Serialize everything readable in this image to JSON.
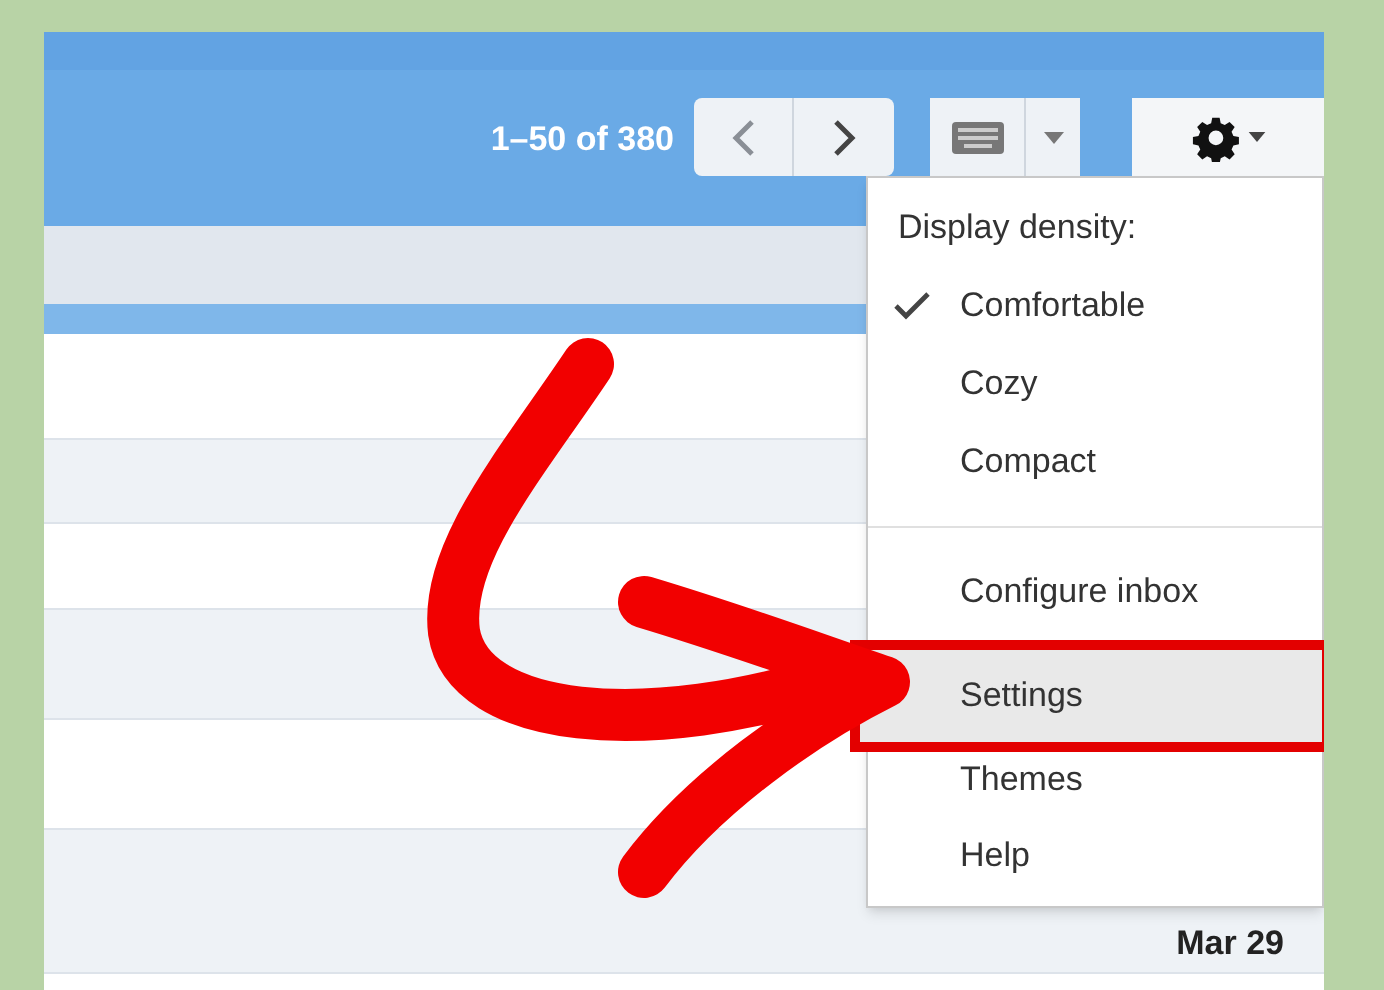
{
  "toolbar": {
    "pagination": "1–50 of 380"
  },
  "settings_menu": {
    "items": [
      {
        "kind": "heading",
        "label": "Display density:"
      },
      {
        "kind": "density",
        "label": "Comfortable",
        "checked": true
      },
      {
        "kind": "density",
        "label": "Cozy",
        "checked": false
      },
      {
        "kind": "density",
        "label": "Compact",
        "checked": false
      },
      {
        "kind": "divider"
      },
      {
        "kind": "action",
        "label": "Configure inbox",
        "selected": false
      },
      {
        "kind": "action",
        "label": "Settings",
        "selected": true
      },
      {
        "kind": "action",
        "label": "Themes",
        "selected": false
      },
      {
        "kind": "action",
        "label": "Help",
        "selected": false
      }
    ]
  },
  "email_list": {
    "rows": [
      {
        "date": ""
      },
      {
        "date": ""
      },
      {
        "date": ""
      },
      {
        "date": ""
      },
      {
        "date": ""
      },
      {
        "date": "Mar 29"
      }
    ]
  }
}
